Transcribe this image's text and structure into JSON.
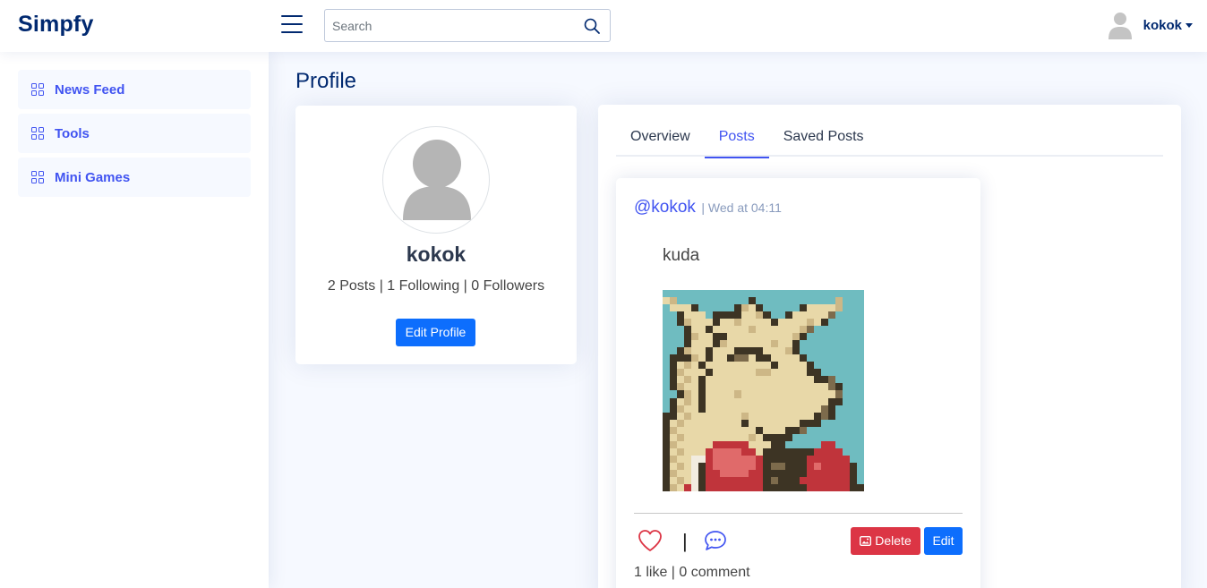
{
  "app": {
    "logo": "Simpfy"
  },
  "header": {
    "search_placeholder": "Search",
    "username": "kokok"
  },
  "sidebar": {
    "items": [
      {
        "label": "News Feed"
      },
      {
        "label": "Tools"
      },
      {
        "label": "Mini Games"
      }
    ]
  },
  "page": {
    "title": "Profile"
  },
  "profile": {
    "name": "kokok",
    "posts": "2 Posts",
    "following": "1 Following",
    "followers": "0 Followers",
    "edit_button": "Edit Profile"
  },
  "tabs": [
    {
      "label": "Overview",
      "active": false
    },
    {
      "label": "Posts",
      "active": true
    },
    {
      "label": "Saved Posts",
      "active": false
    }
  ],
  "post": {
    "author": "@kokok",
    "time": "| Wed at 04:11",
    "text": "kuda",
    "delete_label": "Delete",
    "edit_label": "Edit",
    "likes": "1 like",
    "comments": "0 comment"
  },
  "colors": {
    "brand": "#012970",
    "accent": "#4154f1",
    "primary_button": "#0d6efd",
    "danger_button": "#dc3545"
  }
}
